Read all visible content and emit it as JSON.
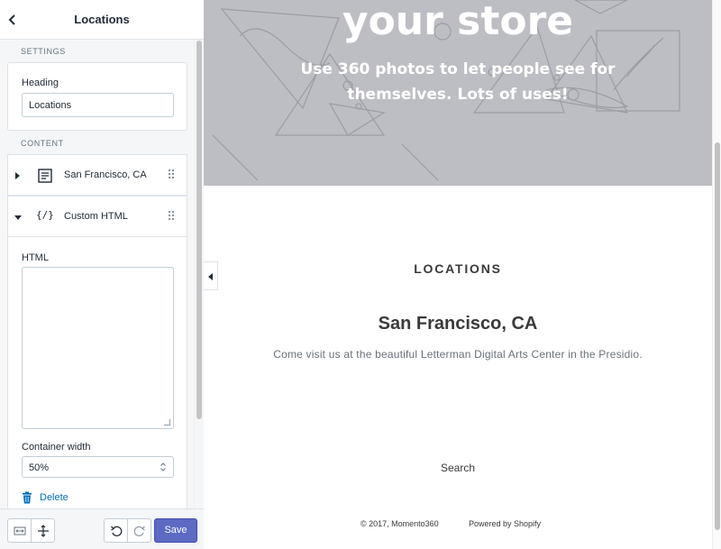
{
  "sidebar": {
    "title": "Locations",
    "settings_label": "SETTINGS",
    "heading_field": {
      "label": "Heading",
      "value": "Locations"
    },
    "content_label": "CONTENT",
    "blocks": [
      {
        "label": "San Francisco, CA",
        "icon": "text-block-icon",
        "expanded": false
      },
      {
        "label": "Custom HTML",
        "icon": "code-icon",
        "icon_glyph": "{/}",
        "expanded": true
      }
    ],
    "html_field": {
      "label": "HTML",
      "value": ""
    },
    "container_width": {
      "label": "Container width",
      "value": "50%"
    },
    "delete_label": "Delete",
    "save_label": "Save",
    "accent_color": "#5c6ac4",
    "link_color": "#006fbb"
  },
  "preview": {
    "hero_title": "your store",
    "hero_subtitle": "Use 360 photos to let people see for themselves. Lots of uses!",
    "section_heading": "LOCATIONS",
    "location_title": "San Francisco, CA",
    "location_text": "Come visit us at the beautiful Letterman Digital Arts Center in the Presidio.",
    "search_link": "Search",
    "copyright": "© 2017, Momento360",
    "powered_by": "Powered by Shopify"
  }
}
